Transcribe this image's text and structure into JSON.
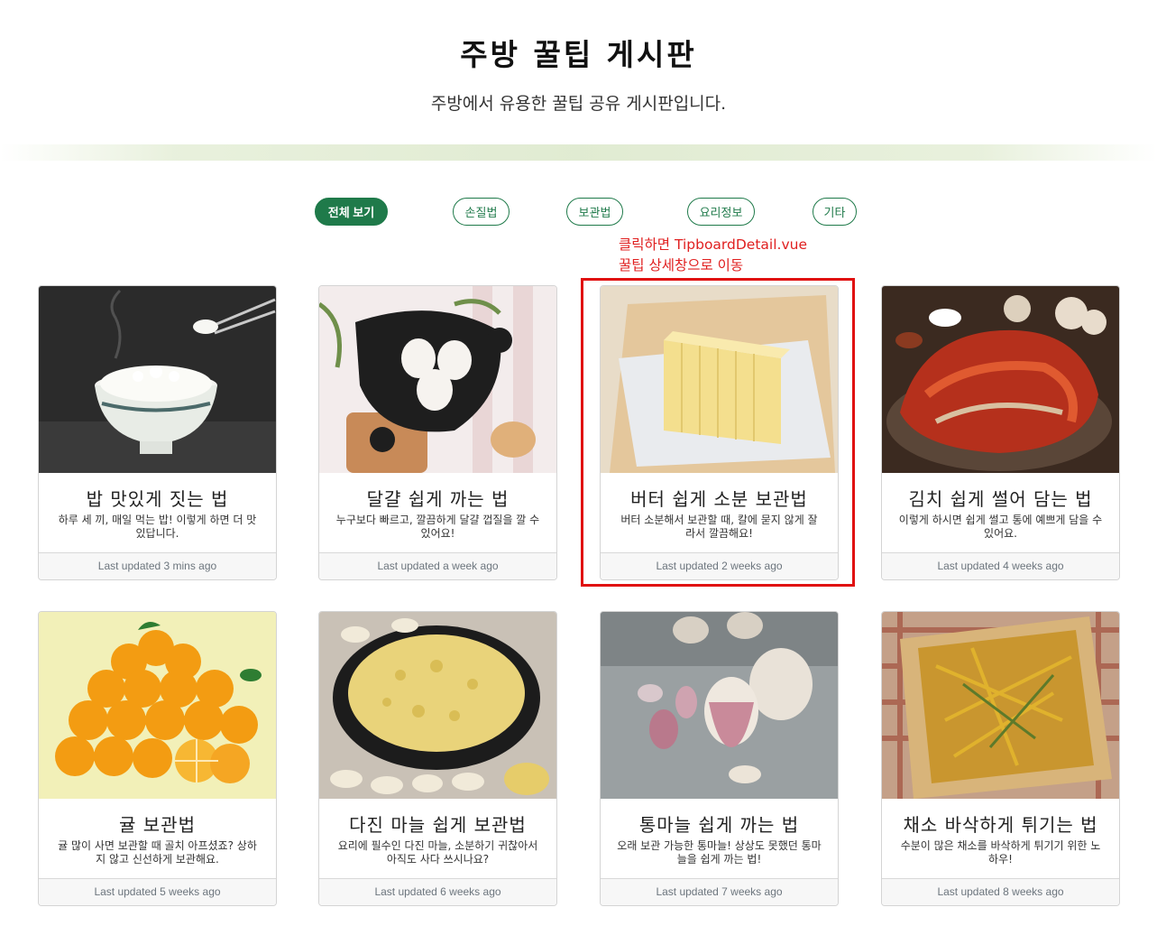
{
  "header": {
    "title": "주방 꿀팁 게시판",
    "subtitle": "주방에서 유용한 꿀팁 공유 게시판입니다."
  },
  "filters": [
    {
      "label": "전체 보기",
      "active": true
    },
    {
      "label": "손질법",
      "active": false
    },
    {
      "label": "보관법",
      "active": false
    },
    {
      "label": "요리정보",
      "active": false
    },
    {
      "label": "기타",
      "active": false
    }
  ],
  "annotation": {
    "line1": "클릭하면 TipboardDetail.vue",
    "line2": "꿀팁 상세창으로 이동",
    "color": "#e02020"
  },
  "colors": {
    "accent": "#1f7a4a",
    "annotation_red": "#e01010"
  },
  "cards": [
    {
      "title": "밥 맛있게 짓는 법",
      "desc": "하루 세 끼, 매일 먹는 밥! 이렇게 하면 더 맛있답니다.",
      "updated": "Last updated 3 mins ago",
      "image": "rice-bowl-image"
    },
    {
      "title": "달걀 쉽게 까는 법",
      "desc": "누구보다 빠르고, 깔끔하게 달걀 껍질을 깔 수 있어요!",
      "updated": "Last updated a week ago",
      "image": "boiled-eggs-image"
    },
    {
      "title": "버터 쉽게 소분 보관법",
      "desc": "버터 소분해서 보관할 때, 칼에 묻지 않게 잘라서 깔끔해요!",
      "updated": "Last updated 2 weeks ago",
      "image": "butter-image"
    },
    {
      "title": "김치 쉽게 썰어 담는 법",
      "desc": "이렇게 하시면 쉽게 썰고 통에 예쁘게 담을 수 있어요.",
      "updated": "Last updated 4 weeks ago",
      "image": "kimchi-image"
    },
    {
      "title": "귤 보관법",
      "desc": "귤 많이 사면 보관할 때 골치 아프셨죠? 상하지 않고 신선하게 보관해요.",
      "updated": "Last updated 5 weeks ago",
      "image": "tangerines-image"
    },
    {
      "title": "다진 마늘 쉽게 보관법",
      "desc": "요리에 필수인 다진 마늘, 소분하기 귀찮아서 아직도 사다 쓰시나요?",
      "updated": "Last updated 6 weeks ago",
      "image": "minced-garlic-image"
    },
    {
      "title": "통마늘 쉽게 까는 법",
      "desc": "오래 보관 가능한 통마늘! 상상도 못했던 통마늘을 쉽게 까는 법!",
      "updated": "Last updated 7 weeks ago",
      "image": "whole-garlic-image"
    },
    {
      "title": "채소 바삭하게 튀기는 법",
      "desc": "수분이 많은 채소를 바삭하게 튀기기 위한 노하우!",
      "updated": "Last updated 8 weeks ago",
      "image": "vegetable-fritter-image"
    }
  ]
}
